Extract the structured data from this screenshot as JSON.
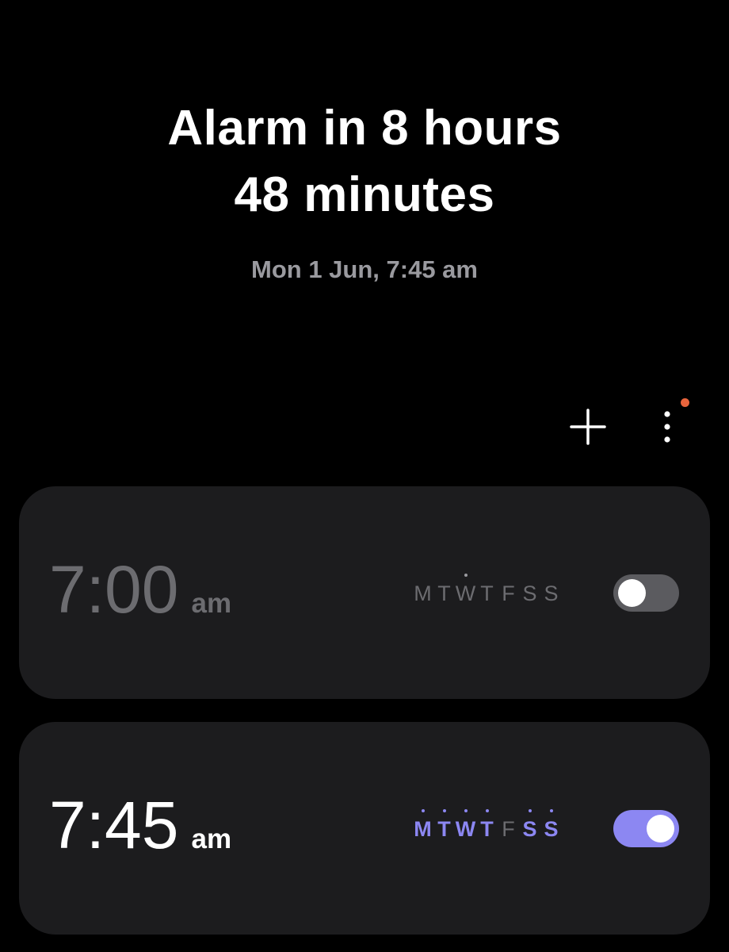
{
  "header": {
    "line1": "Alarm in 8 hours",
    "line2": "48 minutes",
    "next_alarm": "Mon 1 Jun, 7:45 am"
  },
  "toolbar": {
    "add_icon": "plus-icon",
    "more_icon": "more-vertical-icon",
    "notification_dot_color": "#e8643c"
  },
  "alarms": [
    {
      "time": "7:00",
      "ampm": "am",
      "enabled": false,
      "days": [
        {
          "label": "M",
          "active": false,
          "dot": false
        },
        {
          "label": "T",
          "active": false,
          "dot": false
        },
        {
          "label": "W",
          "active": false,
          "dot": true
        },
        {
          "label": "T",
          "active": false,
          "dot": false
        },
        {
          "label": "F",
          "active": false,
          "dot": false
        },
        {
          "label": "S",
          "active": false,
          "dot": false
        },
        {
          "label": "S",
          "active": false,
          "dot": false
        }
      ]
    },
    {
      "time": "7:45",
      "ampm": "am",
      "enabled": true,
      "days": [
        {
          "label": "M",
          "active": true,
          "dot": true
        },
        {
          "label": "T",
          "active": true,
          "dot": true
        },
        {
          "label": "W",
          "active": true,
          "dot": true
        },
        {
          "label": "T",
          "active": true,
          "dot": true
        },
        {
          "label": "F",
          "active": false,
          "dot": false
        },
        {
          "label": "S",
          "active": true,
          "dot": true
        },
        {
          "label": "S",
          "active": true,
          "dot": true
        }
      ]
    }
  ],
  "colors": {
    "background": "#000000",
    "card": "#1c1c1e",
    "accent": "#8c87f2",
    "muted": "#6c6c70",
    "subtitle": "#9a9a9f",
    "toggle_off": "#5b5b5f"
  }
}
